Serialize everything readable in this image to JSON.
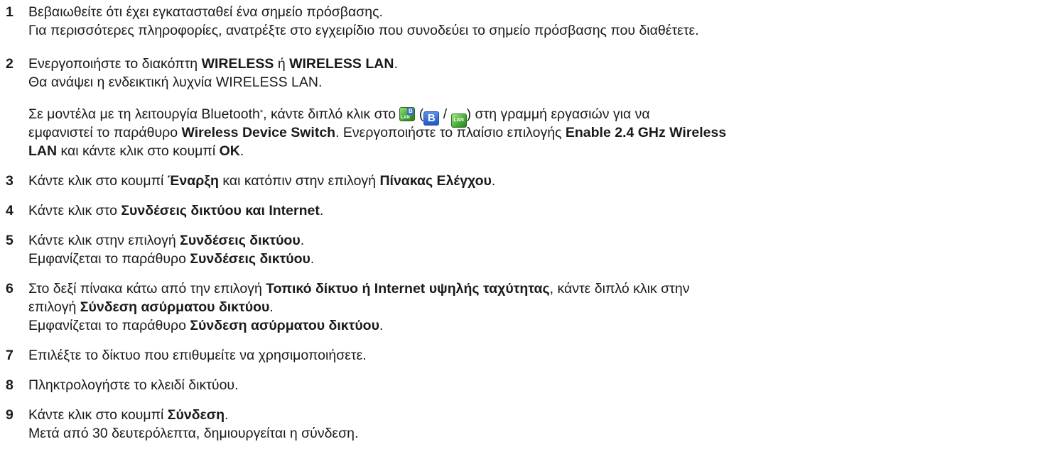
{
  "steps": [
    {
      "number": "1",
      "lines": [
        [
          {
            "t": "Βεβαιωθείτε ότι έχει εγκατασταθεί ένα σημείο πρόσβασης."
          }
        ],
        [
          {
            "t": "Για περισσότερες πληροφορίες, ανατρέξτε στο εγχειρίδιο που συνοδεύει το σημείο πρόσβασης που διαθέτετε."
          }
        ]
      ]
    },
    {
      "number": "2",
      "lines": [
        [
          {
            "t": "Ενεργοποιήστε το διακόπτη "
          },
          {
            "t": "WIRELESS",
            "b": true
          },
          {
            "t": " ή "
          },
          {
            "t": "WIRELESS LAN",
            "b": true
          },
          {
            "t": "."
          }
        ],
        [
          {
            "t": "Θα ανάψει η ενδεικτική λυχνία WIRELESS LAN."
          }
        ],
        [
          {
            "t": "Σε μοντέλα με τη λειτουργία Bluetooth"
          },
          {
            "sup": "*"
          },
          {
            "t": ", κάντε διπλό κλικ στο "
          },
          {
            "icon": "wireless-lan-bluetooth-icon"
          },
          {
            "t": " ("
          },
          {
            "icon": "bluetooth-icon"
          },
          {
            "t": " / "
          },
          {
            "icon": "lan-icon"
          },
          {
            "t": ") στη γραμμή εργασιών για να"
          }
        ],
        [
          {
            "t": "εμφανιστεί το παράθυρο "
          },
          {
            "t": "Wireless Device Switch",
            "b": true
          },
          {
            "t": ". Ενεργοποιήστε το πλαίσιο επιλογής "
          },
          {
            "t": "Enable 2.4 GHz Wireless",
            "b": true
          }
        ],
        [
          {
            "t": "LAN",
            "b": true
          },
          {
            "t": " και κάντε κλικ στο κουμπί "
          },
          {
            "t": "OK",
            "b": true
          },
          {
            "t": "."
          }
        ]
      ]
    },
    {
      "number": "3",
      "lines": [
        [
          {
            "t": "Κάντε κλικ στο κουμπί "
          },
          {
            "t": "Έναρξη",
            "b": true
          },
          {
            "t": " και κατόπιν στην επιλογή "
          },
          {
            "t": "Πίνακας Ελέγχου",
            "b": true
          },
          {
            "t": "."
          }
        ]
      ]
    },
    {
      "number": "4",
      "lines": [
        [
          {
            "t": "Κάντε κλικ στο "
          },
          {
            "t": "Συνδέσεις δικτύου και Internet",
            "b": true
          },
          {
            "t": "."
          }
        ]
      ]
    },
    {
      "number": "5",
      "lines": [
        [
          {
            "t": "Κάντε κλικ στην επιλογή "
          },
          {
            "t": "Συνδέσεις δικτύου",
            "b": true
          },
          {
            "t": "."
          }
        ],
        [
          {
            "t": "Εμφανίζεται το παράθυρο "
          },
          {
            "t": "Συνδέσεις δικτύου",
            "b": true
          },
          {
            "t": "."
          }
        ]
      ]
    },
    {
      "number": "6",
      "lines": [
        [
          {
            "t": "Στο δεξί πίνακα κάτω από την επιλογή "
          },
          {
            "t": "Τοπικό δίκτυο ή Internet υψηλής ταχύτητας",
            "b": true
          },
          {
            "t": ", κάντε διπλό κλικ στην"
          }
        ],
        [
          {
            "t": "επιλογή "
          },
          {
            "t": "Σύνδεση ασύρματου δικτύου",
            "b": true
          },
          {
            "t": "."
          }
        ],
        [
          {
            "t": "Εμφανίζεται το παράθυρο "
          },
          {
            "t": "Σύνδεση ασύρματου δικτύου",
            "b": true
          },
          {
            "t": "."
          }
        ]
      ]
    },
    {
      "number": "7",
      "lines": [
        [
          {
            "t": "Επιλέξτε το δίκτυο που επιθυμείτε να χρησιμοποιήσετε."
          }
        ]
      ]
    },
    {
      "number": "8",
      "lines": [
        [
          {
            "t": "Πληκτρολογήστε το κλειδί δικτύου."
          }
        ]
      ]
    },
    {
      "number": "9",
      "lines": [
        [
          {
            "t": "Κάντε κλικ στο κουμπί "
          },
          {
            "t": "Σύνδεση",
            "b": true
          },
          {
            "t": "."
          }
        ],
        [
          {
            "t": "Μετά από 30 δευτερόλεπτα, δημιουργείται η σύνδεση."
          }
        ]
      ]
    }
  ]
}
